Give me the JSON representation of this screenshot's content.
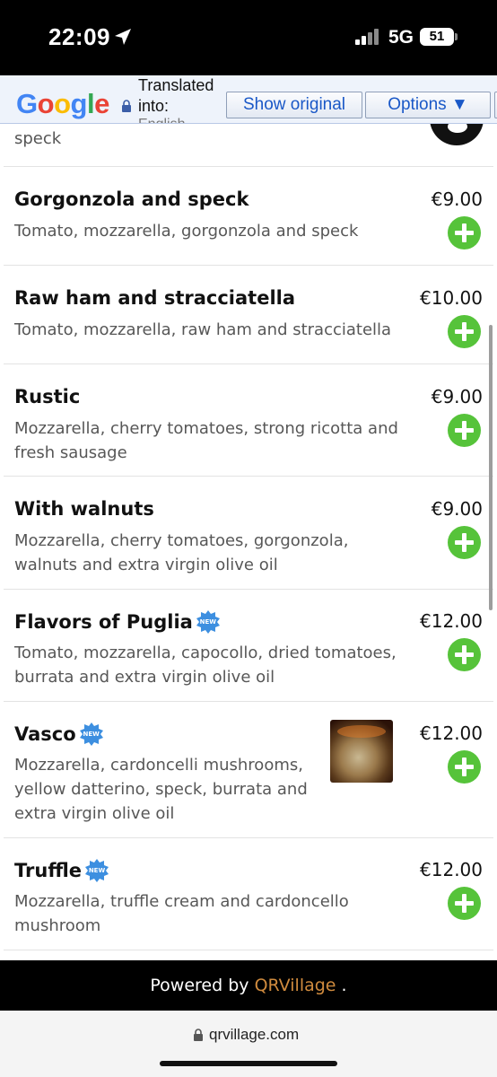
{
  "status_bar": {
    "time": "22:09",
    "network": "5G",
    "battery": "51"
  },
  "translate_bar": {
    "logo": "Google",
    "translated_into_line1": "Translated",
    "translated_into_line2": "into:",
    "translated_into_line3": "English",
    "show_original_label": "Show original",
    "options_label": "Options ▼"
  },
  "menu": {
    "partial_item_desc": "speck",
    "items": [
      {
        "name": "Gorgonzola and speck",
        "description": "Tomato, mozzarella, gorgonzola and speck",
        "price": "€9.00",
        "is_new": false
      },
      {
        "name": "Raw ham and stracciatella",
        "description": "Tomato, mozzarella, raw ham and stracciatella",
        "price": "€10.00",
        "is_new": false
      },
      {
        "name": "Rustic",
        "description": "Mozzarella, cherry tomatoes, strong ricotta and fresh sausage",
        "price": "€9.00",
        "is_new": false
      },
      {
        "name": "With walnuts",
        "description": "Mozzarella, cherry tomatoes, gorgonzola, walnuts and extra virgin olive oil",
        "price": "€9.00",
        "is_new": false
      },
      {
        "name": "Flavors of Puglia",
        "description": "Tomato, mozzarella, capocollo, dried tomatoes, burrata and extra virgin olive oil",
        "price": "€12.00",
        "is_new": true
      },
      {
        "name": "Vasco",
        "description": "Mozzarella, cardoncelli mushrooms, yellow datterino, speck, burrata and extra virgin olive oil",
        "price": "€12.00",
        "is_new": true
      },
      {
        "name": "Truffle",
        "description": "Mozzarella, truffle cream and cardoncello mushroom",
        "price": "€12.00",
        "is_new": true
      }
    ],
    "new_badge_text": "NEW"
  },
  "footer": {
    "powered_prefix": "Powered by ",
    "brand": "QRVillage",
    "powered_suffix": " ."
  },
  "browser": {
    "url": "qrvillage.com"
  },
  "colors": {
    "add_button": "#56c33a",
    "new_badge": "#3d8fe0",
    "brand": "#d08b3e"
  }
}
